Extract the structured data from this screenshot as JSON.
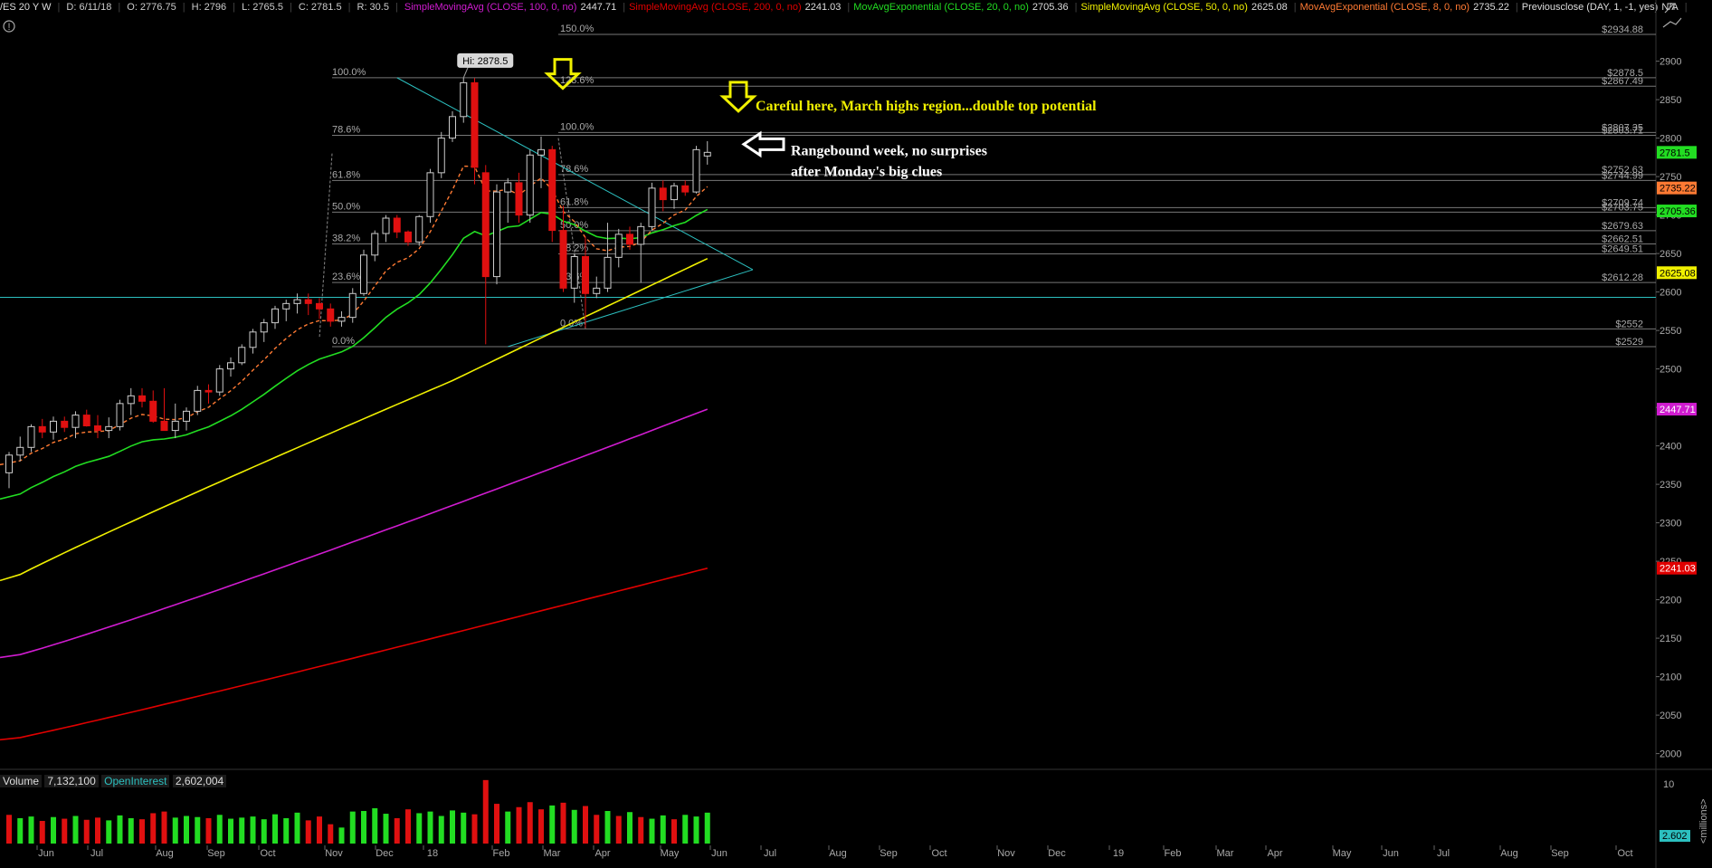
{
  "header": {
    "symbol": "/ES 20 Y W",
    "date": "D: 6/11/18",
    "open": "O: 2776.75",
    "high": "H: 2796",
    "low": "L: 2765.5",
    "close": "C: 2781.5",
    "range": "R: 30.5",
    "studies": [
      {
        "label": "SimpleMovingAvg (CLOSE, 100, 0, no)",
        "value": "2447.71",
        "color": "#d01cd0"
      },
      {
        "label": "SimpleMovingAvg (CLOSE, 200, 0, no)",
        "value": "2241.03",
        "color": "#e00000"
      },
      {
        "label": "MovAvgExponential (CLOSE, 20, 0, no)",
        "value": "2705.36",
        "color": "#22dd22"
      },
      {
        "label": "SimpleMovingAvg (CLOSE, 50, 0, no)",
        "value": "2625.08",
        "color": "#f0f000"
      },
      {
        "label": "MovAvgExponential (CLOSE, 8, 0, no)",
        "value": "2735.22",
        "color": "#ff7a33"
      },
      {
        "label": "Previousclose (DAY, 1, -1, yes)",
        "value": "N/A",
        "color": "#dddddd"
      }
    ]
  },
  "volume_header": {
    "label": "Volume",
    "value": "7,132,100",
    "oi_label": "OpenInterest",
    "oi_value": "2,602,004"
  },
  "volume_axis": {
    "tick": "10",
    "badge": "2.602",
    "unit": "<millions>"
  },
  "colors": {
    "background": "#000000",
    "up": "#22dd22",
    "down": "#e01010",
    "sma100": "#d01cd0",
    "sma200": "#e00000",
    "ema20": "#22dd22",
    "sma50": "#f0f000",
    "ema8": "#ff7a33",
    "trendline": "#2cc0c0",
    "annotation_arrow": "#f0f000",
    "annotation_text": "#f0f000"
  },
  "chart_data": {
    "type": "candlestick",
    "ylim": [
      1975,
      2960
    ],
    "y_ticks": [
      2000,
      2050,
      2100,
      2150,
      2200,
      2250,
      2300,
      2350,
      2400,
      2450,
      2500,
      2550,
      2600,
      2650,
      2700,
      2750,
      2800,
      2850,
      2900
    ],
    "x_labels": [
      "Jun",
      "Jul",
      "Aug",
      "Sep",
      "Oct",
      "Nov",
      "Dec",
      "18",
      "Feb",
      "Mar",
      "Apr",
      "May",
      "Jun",
      "Jul",
      "Aug",
      "Sep",
      "Oct",
      "Nov",
      "Dec",
      "19",
      "Feb",
      "Mar",
      "Apr",
      "May",
      "Jun",
      "Jul",
      "Aug",
      "Sep",
      "Oct"
    ],
    "candles": [
      {
        "date": "2017-06-02",
        "o": 2365,
        "h": 2392,
        "l": 2345,
        "c": 2388
      },
      {
        "date": "2017-06-09",
        "o": 2388,
        "h": 2412,
        "l": 2380,
        "c": 2398
      },
      {
        "date": "2017-06-16",
        "o": 2398,
        "h": 2428,
        "l": 2392,
        "c": 2425
      },
      {
        "date": "2017-06-23",
        "o": 2425,
        "h": 2435,
        "l": 2410,
        "c": 2418
      },
      {
        "date": "2017-06-30",
        "o": 2418,
        "h": 2438,
        "l": 2408,
        "c": 2432
      },
      {
        "date": "2017-07-07",
        "o": 2432,
        "h": 2438,
        "l": 2418,
        "c": 2424
      },
      {
        "date": "2017-07-14",
        "o": 2424,
        "h": 2445,
        "l": 2410,
        "c": 2440
      },
      {
        "date": "2017-07-21",
        "o": 2440,
        "h": 2447,
        "l": 2425,
        "c": 2426
      },
      {
        "date": "2017-07-28",
        "o": 2426,
        "h": 2440,
        "l": 2410,
        "c": 2420
      },
      {
        "date": "2017-08-04",
        "o": 2420,
        "h": 2437,
        "l": 2410,
        "c": 2425
      },
      {
        "date": "2017-08-11",
        "o": 2425,
        "h": 2460,
        "l": 2420,
        "c": 2455
      },
      {
        "date": "2017-08-18",
        "o": 2455,
        "h": 2475,
        "l": 2440,
        "c": 2465
      },
      {
        "date": "2017-08-25",
        "o": 2465,
        "h": 2475,
        "l": 2450,
        "c": 2458
      },
      {
        "date": "2017-09-01",
        "o": 2458,
        "h": 2472,
        "l": 2430,
        "c": 2432
      },
      {
        "date": "2017-09-08",
        "o": 2432,
        "h": 2475,
        "l": 2420,
        "c": 2420
      },
      {
        "date": "2017-09-15",
        "o": 2420,
        "h": 2455,
        "l": 2410,
        "c": 2432
      },
      {
        "date": "2017-09-22",
        "o": 2432,
        "h": 2450,
        "l": 2420,
        "c": 2445
      },
      {
        "date": "2017-09-29",
        "o": 2445,
        "h": 2478,
        "l": 2440,
        "c": 2472
      },
      {
        "date": "2017-10-06",
        "o": 2472,
        "h": 2480,
        "l": 2455,
        "c": 2470
      },
      {
        "date": "2017-10-13",
        "o": 2470,
        "h": 2505,
        "l": 2465,
        "c": 2500
      },
      {
        "date": "2017-10-20",
        "o": 2500,
        "h": 2515,
        "l": 2490,
        "c": 2508
      },
      {
        "date": "2017-10-27",
        "o": 2508,
        "h": 2532,
        "l": 2505,
        "c": 2528
      },
      {
        "date": "2017-11-03",
        "o": 2528,
        "h": 2552,
        "l": 2520,
        "c": 2548
      },
      {
        "date": "2017-11-10",
        "o": 2548,
        "h": 2565,
        "l": 2535,
        "c": 2560
      },
      {
        "date": "2017-11-17",
        "o": 2560,
        "h": 2582,
        "l": 2552,
        "c": 2578
      },
      {
        "date": "2017-11-24",
        "o": 2578,
        "h": 2590,
        "l": 2562,
        "c": 2585
      },
      {
        "date": "2017-12-01",
        "o": 2585,
        "h": 2598,
        "l": 2572,
        "c": 2590
      },
      {
        "date": "2017-12-08",
        "o": 2590,
        "h": 2598,
        "l": 2570,
        "c": 2585
      },
      {
        "date": "2017-12-15",
        "o": 2585,
        "h": 2592,
        "l": 2565,
        "c": 2578
      },
      {
        "date": "2017-12-22",
        "o": 2578,
        "h": 2585,
        "l": 2555,
        "c": 2562
      },
      {
        "date": "2017-12-29",
        "o": 2562,
        "h": 2575,
        "l": 2555,
        "c": 2567
      },
      {
        "date": "2018-01-05",
        "o": 2567,
        "h": 2605,
        "l": 2560,
        "c": 2598
      },
      {
        "date": "2018-01-12",
        "o": 2598,
        "h": 2655,
        "l": 2595,
        "c": 2648
      },
      {
        "date": "2018-01-19",
        "o": 2648,
        "h": 2680,
        "l": 2640,
        "c": 2676
      },
      {
        "date": "2018-01-26",
        "o": 2676,
        "h": 2700,
        "l": 2665,
        "c": 2696
      },
      {
        "date": "2018-02-02",
        "o": 2696,
        "h": 2700,
        "l": 2670,
        "c": 2678
      },
      {
        "date": "2018-02-09",
        "o": 2678,
        "h": 2680,
        "l": 2660,
        "c": 2665
      },
      {
        "date": "2018-02-16",
        "o": 2665,
        "h": 2700,
        "l": 2660,
        "c": 2698
      },
      {
        "date": "2018-02-23",
        "o": 2698,
        "h": 2760,
        "l": 2690,
        "c": 2755
      },
      {
        "date": "2018-03-02",
        "o": 2755,
        "h": 2808,
        "l": 2748,
        "c": 2800
      },
      {
        "date": "2018-03-09",
        "o": 2800,
        "h": 2835,
        "l": 2795,
        "c": 2828
      },
      {
        "date": "2018-03-16",
        "o": 2828,
        "h": 2878.5,
        "l": 2820,
        "c": 2872
      },
      {
        "date": "2018-03-23",
        "o": 2872,
        "h": 2878,
        "l": 2740,
        "c": 2762
      },
      {
        "date": "2018-03-30",
        "o": 2755,
        "h": 2765,
        "l": 2532,
        "c": 2620
      },
      {
        "date": "2018-04-06",
        "o": 2620,
        "h": 2740,
        "l": 2610,
        "c": 2730
      },
      {
        "date": "2018-04-13",
        "o": 2730,
        "h": 2748,
        "l": 2690,
        "c": 2742
      },
      {
        "date": "2018-04-20",
        "o": 2742,
        "h": 2755,
        "l": 2690,
        "c": 2700
      },
      {
        "date": "2018-04-27",
        "o": 2700,
        "h": 2785,
        "l": 2690,
        "c": 2778
      },
      {
        "date": "2018-05-04",
        "o": 2778,
        "h": 2802,
        "l": 2735,
        "c": 2785
      },
      {
        "date": "2018-05-11",
        "o": 2785,
        "h": 2790,
        "l": 2665,
        "c": 2680
      },
      {
        "date": "2018-05-18",
        "o": 2680,
        "h": 2712,
        "l": 2600,
        "c": 2605
      },
      {
        "date": "2018-05-25",
        "o": 2605,
        "h": 2650,
        "l": 2586,
        "c": 2646
      },
      {
        "date": "2018-06-01",
        "o": 2646,
        "h": 2672,
        "l": 2553,
        "c": 2598
      },
      {
        "date": "2018-06-08",
        "o": 2598,
        "h": 2620,
        "l": 2592,
        "c": 2605
      },
      {
        "date": "2018-06-15",
        "o": 2605,
        "h": 2690,
        "l": 2600,
        "c": 2645
      },
      {
        "date": "2018-06-22",
        "o": 2645,
        "h": 2682,
        "l": 2632,
        "c": 2675
      },
      {
        "date": "2018-06-29",
        "o": 2675,
        "h": 2685,
        "l": 2655,
        "c": 2662
      },
      {
        "date": "2018-07-06",
        "o": 2662,
        "h": 2690,
        "l": 2612,
        "c": 2685
      },
      {
        "date": "2018-07-13",
        "o": 2685,
        "h": 2742,
        "l": 2680,
        "c": 2735
      },
      {
        "date": "2018-07-20",
        "o": 2735,
        "h": 2745,
        "l": 2705,
        "c": 2720
      },
      {
        "date": "2018-07-27",
        "o": 2720,
        "h": 2742,
        "l": 2708,
        "c": 2738
      },
      {
        "date": "2018-08-03",
        "o": 2738,
        "h": 2745,
        "l": 2725,
        "c": 2730
      },
      {
        "date": "2018-08-10",
        "o": 2730,
        "h": 2790,
        "l": 2728,
        "c": 2785
      },
      {
        "date": "2018-08-17",
        "o": 2776.75,
        "h": 2796,
        "l": 2765.5,
        "c": 2781.5
      }
    ],
    "series": [
      {
        "name": "SimpleMovingAvg (CLOSE, 100, 0, no)",
        "color": "#d01cd0"
      },
      {
        "name": "SimpleMovingAvg (CLOSE, 200, 0, no)",
        "color": "#e00000"
      },
      {
        "name": "MovAvgExponential (CLOSE, 20, 0, no)",
        "color": "#22dd22"
      },
      {
        "name": "SimpleMovingAvg (CLOSE, 50, 0, no)",
        "color": "#f0f000"
      },
      {
        "name": "MovAvgExponential (CLOSE, 8, 0, no)",
        "color": "#ff7a33"
      }
    ],
    "price_lines": [
      {
        "label": "$2934.88",
        "value": 2934.88
      },
      {
        "label": "$2878.5",
        "value": 2878.5
      },
      {
        "label": "$2867.49",
        "value": 2867.49
      },
      {
        "label": "$2807.35",
        "value": 2807.35
      },
      {
        "label": "$2803.71",
        "value": 2803.71
      },
      {
        "label": "$2752.63",
        "value": 2752.63
      },
      {
        "label": "$2744.99",
        "value": 2744.99
      },
      {
        "label": "$2709.74",
        "value": 2709.74
      },
      {
        "label": "$2703.75",
        "value": 2703.75
      },
      {
        "label": "$2679.63",
        "value": 2679.63
      },
      {
        "label": "$2662.51",
        "value": 2662.51
      },
      {
        "label": "$2649.51",
        "value": 2649.51
      },
      {
        "label": "$2612.28",
        "value": 2612.28
      },
      {
        "label": "$2552",
        "value": 2552
      },
      {
        "label": "$2529",
        "value": 2529
      }
    ],
    "fib_labels_left": [
      {
        "text": "100.0%",
        "value": 2878.5
      },
      {
        "text": "78.6%",
        "value": 2803.71
      },
      {
        "text": "61.8%",
        "value": 2744.99
      },
      {
        "text": "50.0%",
        "value": 2703.75
      },
      {
        "text": "38.2%",
        "value": 2662.51
      },
      {
        "text": "23.6%",
        "value": 2612.28
      },
      {
        "text": "0.0%",
        "value": 2529
      }
    ],
    "fib_labels_right": [
      {
        "text": "150.0%",
        "value": 2934.88
      },
      {
        "text": "123.6%",
        "value": 2867.49
      },
      {
        "text": "100.0%",
        "value": 2807.35
      },
      {
        "text": "78.6%",
        "value": 2752.63
      },
      {
        "text": "61.8%",
        "value": 2709.74
      },
      {
        "text": "50.0%",
        "value": 2679.63
      },
      {
        "text": "38.2%",
        "value": 2649.51
      },
      {
        "text": "23.6%",
        "value": 2612.28
      },
      {
        "text": "0.0%",
        "value": 2552
      }
    ],
    "hi_label": "Hi: 2878.5",
    "horizontal_line": 2593,
    "badges": [
      {
        "text": "2781.5",
        "value": 2781.5,
        "bg": "#22dd22",
        "fg": "#000"
      },
      {
        "text": "2735.22",
        "value": 2735.22,
        "bg": "#ff7a33",
        "fg": "#000"
      },
      {
        "text": "2705.36",
        "value": 2705.36,
        "bg": "#22dd22",
        "fg": "#000"
      },
      {
        "text": "2625.08",
        "value": 2625.08,
        "bg": "#f0f000",
        "fg": "#000"
      },
      {
        "text": "2447.71",
        "value": 2447.71,
        "bg": "#d01cd0",
        "fg": "#fff"
      },
      {
        "text": "2241.03",
        "value": 2241.03,
        "bg": "#e00000",
        "fg": "#fff"
      }
    ],
    "annotations": [
      {
        "text": "Careful here, March highs region...double top potential",
        "color": "#f0f000",
        "value": 2843
      },
      {
        "text": "Rangebound week, no surprises",
        "color": "#ffffff",
        "value": 2785
      },
      {
        "text": "after Monday's big clues",
        "color": "#ffffff",
        "value": 2758
      }
    ],
    "volume": [
      {
        "v": 5.2,
        "up": false
      },
      {
        "v": 4.6,
        "up": true
      },
      {
        "v": 4.9,
        "up": true
      },
      {
        "v": 4.1,
        "up": false
      },
      {
        "v": 4.8,
        "up": true
      },
      {
        "v": 4.5,
        "up": false
      },
      {
        "v": 5.0,
        "up": true
      },
      {
        "v": 4.3,
        "up": false
      },
      {
        "v": 4.7,
        "up": false
      },
      {
        "v": 4.2,
        "up": true
      },
      {
        "v": 5.1,
        "up": true
      },
      {
        "v": 4.6,
        "up": true
      },
      {
        "v": 4.4,
        "up": false
      },
      {
        "v": 5.5,
        "up": false
      },
      {
        "v": 5.8,
        "up": false
      },
      {
        "v": 4.7,
        "up": true
      },
      {
        "v": 5.0,
        "up": true
      },
      {
        "v": 4.8,
        "up": true
      },
      {
        "v": 4.6,
        "up": false
      },
      {
        "v": 5.2,
        "up": true
      },
      {
        "v": 4.5,
        "up": true
      },
      {
        "v": 4.7,
        "up": true
      },
      {
        "v": 4.9,
        "up": true
      },
      {
        "v": 4.4,
        "up": true
      },
      {
        "v": 5.3,
        "up": true
      },
      {
        "v": 4.6,
        "up": true
      },
      {
        "v": 5.6,
        "up": true
      },
      {
        "v": 4.2,
        "up": false
      },
      {
        "v": 4.9,
        "up": false
      },
      {
        "v": 3.5,
        "up": false
      },
      {
        "v": 2.9,
        "up": true
      },
      {
        "v": 5.8,
        "up": true
      },
      {
        "v": 5.9,
        "up": true
      },
      {
        "v": 6.4,
        "up": true
      },
      {
        "v": 5.4,
        "up": true
      },
      {
        "v": 4.6,
        "up": false
      },
      {
        "v": 6.2,
        "up": false
      },
      {
        "v": 5.5,
        "up": true
      },
      {
        "v": 5.8,
        "up": true
      },
      {
        "v": 5.0,
        "up": true
      },
      {
        "v": 6.0,
        "up": true
      },
      {
        "v": 5.6,
        "up": true
      },
      {
        "v": 5.3,
        "up": false
      },
      {
        "v": 11.5,
        "up": false
      },
      {
        "v": 7.2,
        "up": false
      },
      {
        "v": 5.8,
        "up": true
      },
      {
        "v": 6.6,
        "up": false
      },
      {
        "v": 7.5,
        "up": false
      },
      {
        "v": 6.2,
        "up": false
      },
      {
        "v": 6.9,
        "up": true
      },
      {
        "v": 7.4,
        "up": false
      },
      {
        "v": 6.1,
        "up": true
      },
      {
        "v": 6.8,
        "up": false
      },
      {
        "v": 5.2,
        "up": false
      },
      {
        "v": 5.9,
        "up": true
      },
      {
        "v": 5.0,
        "up": false
      },
      {
        "v": 5.7,
        "up": true
      },
      {
        "v": 4.8,
        "up": false
      },
      {
        "v": 4.5,
        "up": true
      },
      {
        "v": 5.1,
        "up": true
      },
      {
        "v": 4.4,
        "up": false
      },
      {
        "v": 5.2,
        "up": true
      },
      {
        "v": 4.9,
        "up": true
      },
      {
        "v": 5.6,
        "up": true
      }
    ]
  }
}
